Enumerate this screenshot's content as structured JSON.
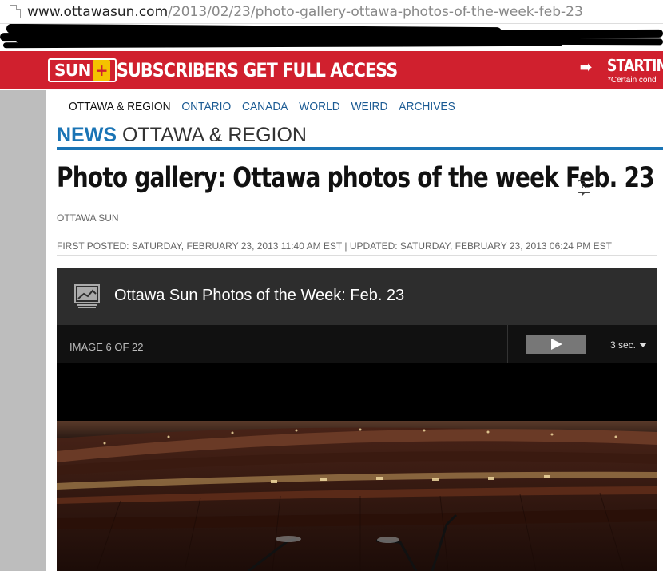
{
  "browser": {
    "url_host": "www.ottawasun.com",
    "url_path": "/2013/02/23/photo-gallery-ottawa-photos-of-the-week-feb-23"
  },
  "promo": {
    "logo": "SUN",
    "logo_plus": "+",
    "text": "SUBSCRIBERS GET FULL ACCESS",
    "right_text": "STARTING",
    "right_note": "*Certain cond",
    "color": "#d0202e"
  },
  "nav": {
    "items": [
      {
        "label": "OTTAWA & REGION",
        "active": true
      },
      {
        "label": "ONTARIO"
      },
      {
        "label": "CANADA"
      },
      {
        "label": "WORLD"
      },
      {
        "label": "WEIRD"
      },
      {
        "label": "ARCHIVES"
      }
    ]
  },
  "section": {
    "news": "NEWS",
    "region": "OTTAWA & REGION",
    "accent": "#1a74b5"
  },
  "article": {
    "headline": "Photo gallery: Ottawa photos of the week Feb. 23",
    "comment_count": "0",
    "byline": "OTTAWA SUN",
    "dateline": "FIRST POSTED: SATURDAY, FEBRUARY 23, 2013 11:40 AM EST | UPDATED: SATURDAY, FEBRUARY 23, 2013 06:24 PM EST"
  },
  "gallery": {
    "title": "Ottawa Sun Photos of the Week: Feb. 23",
    "counter": "IMAGE 6 OF 22",
    "speed": "3 sec.",
    "icons": {
      "gallery": "photo-stack-icon",
      "play": "play-icon",
      "speed": "chevron-down-icon"
    }
  }
}
